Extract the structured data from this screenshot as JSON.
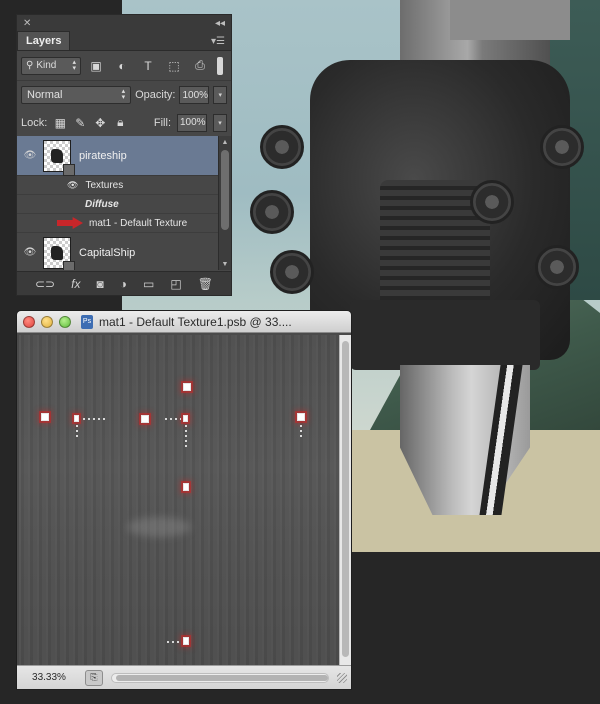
{
  "layers_panel": {
    "tab_label": "Layers",
    "filter_kind": "Kind",
    "blend_mode": "Normal",
    "opacity_label": "Opacity:",
    "opacity_value": "100%",
    "lock_label": "Lock:",
    "fill_label": "Fill:",
    "fill_value": "100%",
    "layers": [
      {
        "name": "pirateship",
        "selected": true,
        "textures_label": "Textures",
        "diffuse_label": "Diffuse",
        "texture_name": "mat1 - Default Texture"
      },
      {
        "name": "CapitalShip",
        "selected": false
      }
    ]
  },
  "document": {
    "title": "mat1 - Default Texture1.psb @ 33....",
    "zoom": "33.33%"
  },
  "colors": {
    "panel_bg": "#474747",
    "selection": "#6a7a93",
    "arrow_accent": "#c8262a"
  }
}
